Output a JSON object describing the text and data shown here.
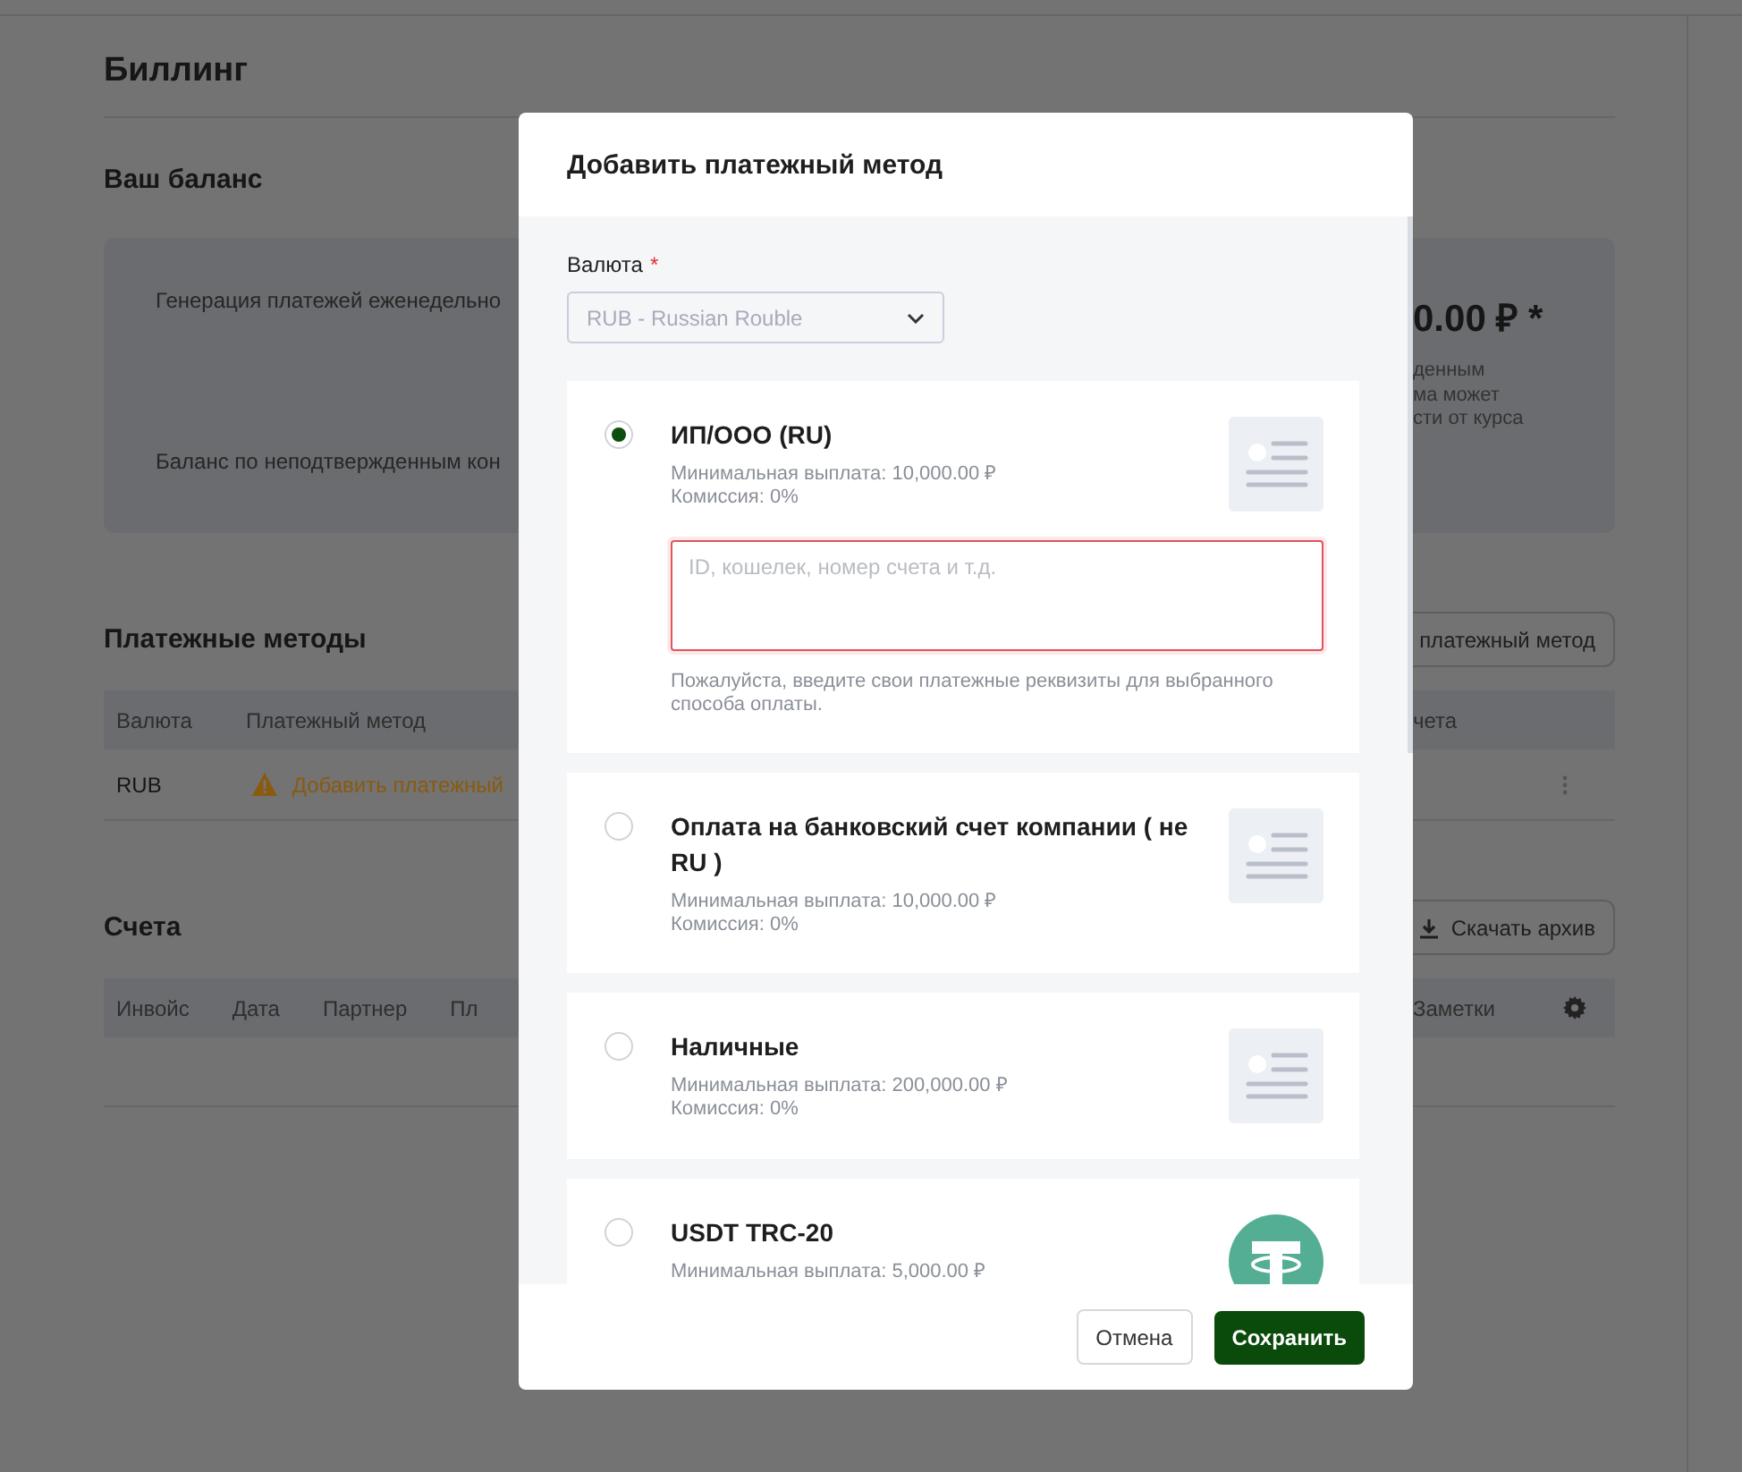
{
  "page": {
    "title": "Биллинг"
  },
  "balance": {
    "title": "Ваш баланс",
    "rows": [
      "Генерация платежей еженедельно",
      "Баланс по неподтвержденным кон"
    ],
    "amount": "0.00 ₽ *",
    "note_lines": [
      "денным",
      "ма может",
      "сти от курса"
    ]
  },
  "payment_methods": {
    "title": "Платежные методы",
    "add_button": "платежный метод",
    "columns": [
      "Валюта",
      "Платежный метод",
      "чета"
    ],
    "rows": [
      {
        "currency": "RUB",
        "method": "Добавить платежный"
      }
    ]
  },
  "invoices": {
    "title": "Счета",
    "download_button": "Скачать архив",
    "columns": [
      "Инвойс",
      "Дата",
      "Партнер",
      "Пл",
      "Заметки"
    ]
  },
  "dialog": {
    "title": "Добавить платежный метод",
    "currency_label": "Валюта",
    "required_mark": "*",
    "currency": {
      "value": "RUB - Russian Rouble",
      "disabled": true
    },
    "methods": [
      {
        "name": "ИП/ООО (RU)",
        "min_payout": "Минимальная выплата: 10,000.00 ₽",
        "commission": "Комиссия: 0%",
        "selected": true,
        "kind": "generic",
        "details": {
          "placeholder": "ID, кошелек, номер счета и т.д.",
          "hint": "Пожалуйста, введите свои платежные реквизиты для выбранного способа оплаты.",
          "invalid": true
        }
      },
      {
        "name": "Оплата на банковский счет компании ( не RU )",
        "min_payout": "Минимальная выплата: 10,000.00 ₽",
        "commission": "Комиссия: 0%",
        "selected": false,
        "kind": "generic"
      },
      {
        "name": "Наличные",
        "min_payout": "Минимальная выплата: 200,000.00 ₽",
        "commission": "Комиссия: 0%",
        "selected": false,
        "kind": "generic"
      },
      {
        "name": "USDT TRC-20",
        "min_payout": "Минимальная выплата: 5,000.00 ₽",
        "selected": false,
        "kind": "tether"
      }
    ],
    "buttons": {
      "cancel": "Отмена",
      "save": "Сохранить"
    }
  }
}
